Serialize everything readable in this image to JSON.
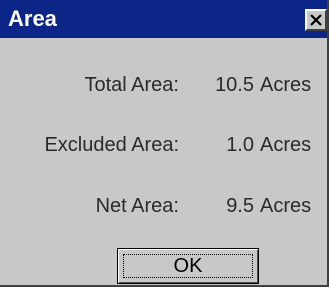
{
  "window": {
    "title": "Area",
    "close_icon": "close-icon"
  },
  "rows": [
    {
      "label": "Total Area:",
      "value": "10.5",
      "unit": "Acres"
    },
    {
      "label": "Excluded Area:",
      "value": "1.0",
      "unit": "Acres"
    },
    {
      "label": "Net Area:",
      "value": "9.5",
      "unit": "Acres"
    }
  ],
  "buttons": {
    "ok_label": "OK"
  },
  "colors": {
    "titlebar": "#0b2686",
    "dialog_background": "#c8c8c8",
    "title_text": "#ffffff"
  }
}
